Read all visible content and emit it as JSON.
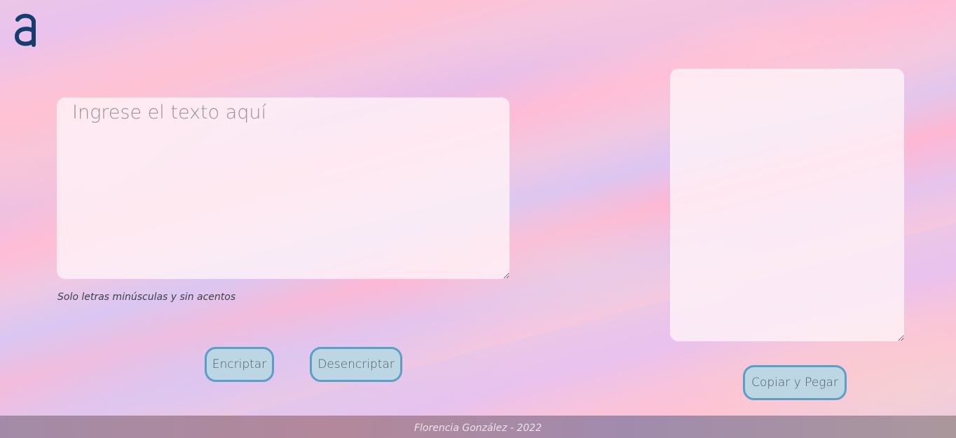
{
  "logo": {
    "icon": "letter-a-logo",
    "color": "#173d6e"
  },
  "input": {
    "placeholder": "Ingrese el texto aquí",
    "value": ""
  },
  "hint": {
    "text": "Solo letras minúsculas y sin acentos"
  },
  "buttons": {
    "encrypt_label": "Encriptar",
    "decrypt_label": "Desencriptar",
    "copy_label": "Copiar y Pegar"
  },
  "output": {
    "value": ""
  },
  "footer": {
    "text": "Florencia González - 2022"
  },
  "colors": {
    "button_border": "#5b9ec6",
    "button_fill": "#bcd7e3",
    "logo": "#173d6e"
  }
}
